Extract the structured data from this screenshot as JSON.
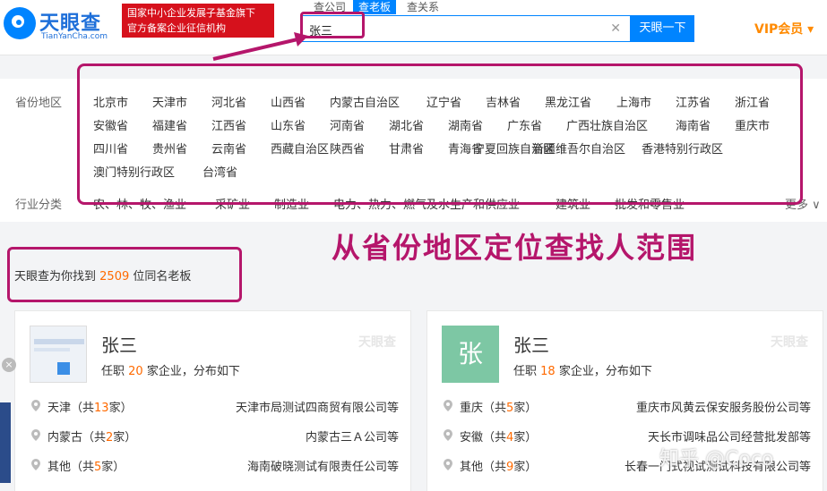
{
  "header": {
    "logo_title": "天眼查",
    "logo_sub": "TianYanCha.com",
    "badge_line1": "国家中小企业发展子基金旗下",
    "badge_line2": "官方备案企业征信机构",
    "tabs": [
      {
        "label": "查公司"
      },
      {
        "label": "查老板"
      },
      {
        "label": "查关系"
      }
    ],
    "search_value": "张三",
    "clear_glyph": "✕",
    "search_button": "天眼一下",
    "vip": "VIP会员 ▾"
  },
  "filter": {
    "province_label": "省份地区",
    "industry_label": "行业分类",
    "provinces": [
      "北京市",
      "天津市",
      "河北省",
      "山西省",
      "内蒙古自治区",
      "辽宁省",
      "吉林省",
      "黑龙江省",
      "上海市",
      "江苏省",
      "浙江省",
      "安徽省",
      "福建省",
      "江西省",
      "山东省",
      "河南省",
      "湖北省",
      "湖南省",
      "广东省",
      "广西壮族自治区",
      "海南省",
      "重庆市",
      "四川省",
      "贵州省",
      "云南省",
      "西藏自治区",
      "陕西省",
      "甘肃省",
      "青海省",
      "宁夏回族自治区",
      "新疆维吾尔自治区",
      "香港特别行政区",
      "澳门特别行政区",
      "台湾省"
    ],
    "industries": [
      "农、林、牧、渔业",
      "采矿业",
      "制造业",
      "电力、热力、燃气及水生产和供应业",
      "建筑业",
      "批发和零售业"
    ],
    "more": "更多 ∨"
  },
  "annotation": {
    "text": "从省份地区定位查找人范围",
    "color": "#b5166b"
  },
  "result": {
    "prefix": "天眼查为你找到",
    "count": "2509",
    "suffix": "位同名老板"
  },
  "cards": [
    {
      "name": "张三",
      "role_prefix": "任职",
      "role_count": "20",
      "role_suffix": "家企业，分布如下",
      "watermark": "天眼查",
      "rows": [
        {
          "region": "天津（共",
          "num": "13",
          "unit": "家）",
          "company": "天津市局测试四商贸有限公司等"
        },
        {
          "region": "内蒙古（共",
          "num": "2",
          "unit": "家）",
          "company": "内蒙古三Ａ公司等"
        },
        {
          "region": "其他（共",
          "num": "5",
          "unit": "家）",
          "company": "海南破晓测试有限责任公司等"
        }
      ]
    },
    {
      "name": "张三",
      "avatar_letter": "张",
      "role_prefix": "任职",
      "role_count": "18",
      "role_suffix": "家企业，分布如下",
      "watermark": "天眼查",
      "rows": [
        {
          "region": "重庆（共",
          "num": "5",
          "unit": "家）",
          "company": "重庆市风黄云保安服务股份公司等"
        },
        {
          "region": "安徽（共",
          "num": "4",
          "unit": "家）",
          "company": "天长市调味品公司经营批发部等"
        },
        {
          "region": "其他（共",
          "num": "9",
          "unit": "家）",
          "company": "长春一门式视试测试科技有限公司等"
        }
      ]
    }
  ],
  "watermark": "知乎 @Coco"
}
